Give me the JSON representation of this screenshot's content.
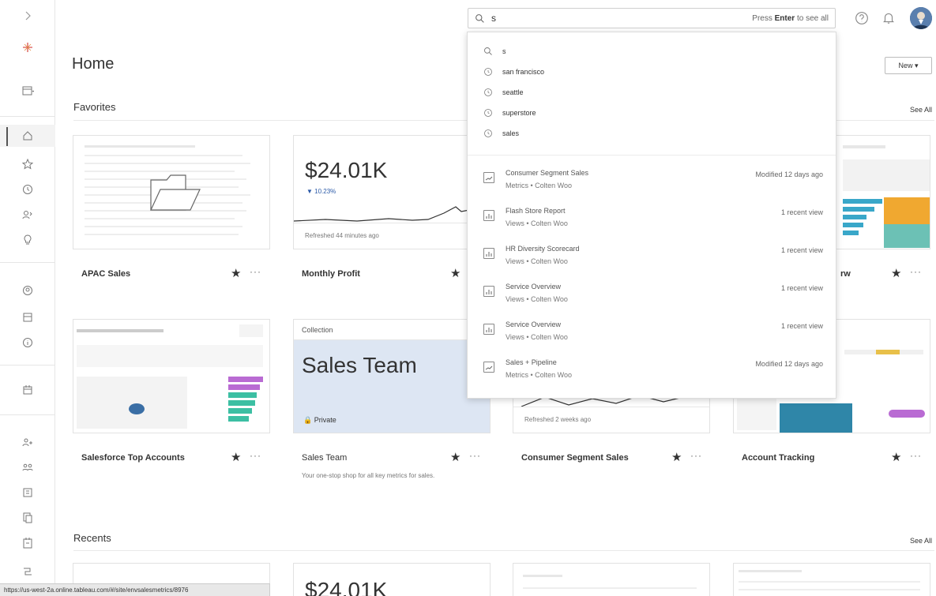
{
  "search": {
    "query": "s",
    "hint_prefix": "Press",
    "hint_key": "Enter",
    "hint_suffix": "to see all"
  },
  "header": {
    "page_title": "Home",
    "new_button": "New ▾"
  },
  "sections": {
    "favorites": "Favorites",
    "recents": "Recents",
    "see_all": "See All"
  },
  "favorites": {
    "card1": {
      "label": "APAC Sales"
    },
    "card2": {
      "label": "Monthly Profit",
      "kpi": "$24.01K",
      "delta": "▼ 10.23%",
      "refreshed": "Refreshed 44 minutes ago"
    },
    "card4": {
      "label": "rw"
    },
    "card5": {
      "label": "Salesforce Top Accounts"
    },
    "card6": {
      "label": "Sales Team",
      "type": "Collection",
      "title": "Sales Team",
      "private": "🔒 Private",
      "desc": "Your one-stop shop for all key metrics for sales."
    },
    "card7": {
      "label": "Consumer Segment Sales",
      "refreshed": "Refreshed 2 weeks ago"
    },
    "card8": {
      "label": "Account Tracking"
    }
  },
  "recents": {
    "card2_kpi": "$24.01K"
  },
  "dropdown": {
    "query_row": "s",
    "history": [
      "san francisco",
      "seattle",
      "superstore",
      "sales"
    ],
    "results": [
      {
        "title": "Consumer Segment Sales",
        "sub": "Metrics • Colten Woo",
        "meta": "Modified 12 days ago",
        "kind": "metric"
      },
      {
        "title": "Flash Store Report",
        "sub": "Views • Colten Woo",
        "meta": "1 recent view",
        "kind": "view"
      },
      {
        "title": "HR Diversity Scorecard",
        "sub": "Views • Colten Woo",
        "meta": "1 recent view",
        "kind": "view"
      },
      {
        "title": "Service Overview",
        "sub": "Views • Colten Woo",
        "meta": "1 recent view",
        "kind": "view"
      },
      {
        "title": "Service Overview",
        "sub": "Views • Colten Woo",
        "meta": "1 recent view",
        "kind": "view"
      },
      {
        "title": "Sales + Pipeline",
        "sub": "Metrics • Colten Woo",
        "meta": "Modified 12 days ago",
        "kind": "metric"
      }
    ]
  },
  "statusbar": {
    "url": "https://us-west-2a.online.tableau.com/#/site/envsalesmetrics/8976"
  },
  "colors": {
    "accent": "#2b5aa8",
    "collection_bg": "#dde6f3",
    "border": "#e2e2e2"
  }
}
